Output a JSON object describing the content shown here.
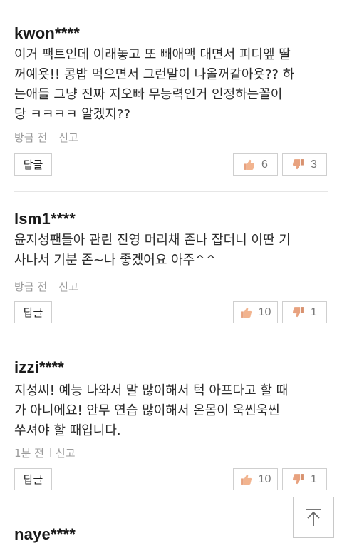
{
  "comments": [
    {
      "author": "kwon****",
      "lines": [
        "이거 팩트인데 이래놓고 또 빼애액 대면서 피디엪 딸",
        "꺼예욧!! 콩밥 먹으면서 그런말이 나올꺼같아욧?? 하",
        "는애들 그냥 진짜 지오빠 무능력인거 인정하는꼴이",
        "당 ㅋㅋㅋㅋ 알겠지??"
      ],
      "time": "방금 전",
      "report": "신고",
      "reply": "답글",
      "likes": "6",
      "dislikes": "3"
    },
    {
      "author": "lsm1****",
      "lines": [
        "윤지성팬들아 관린 진영 머리채 존나 잡더니 이딴 기",
        "사나서 기분 존~나 좋겠어요 아주^^"
      ],
      "time": "방금 전",
      "report": "신고",
      "reply": "답글",
      "likes": "10",
      "dislikes": "1"
    },
    {
      "author": "izzi****",
      "lines": [
        "지성씨! 예능 나와서 말 많이해서 턱 아프다고 할 때",
        "가 아니에요! 안무 연습 많이해서 온몸이 욱씬욱씬",
        "쑤셔야 할 때입니다."
      ],
      "time": "1분 전",
      "report": "신고",
      "reply": "답글",
      "likes": "10",
      "dislikes": "1"
    },
    {
      "author": "naye****"
    }
  ],
  "icons": {
    "like": "thumbs-up-icon",
    "dislike": "thumbs-down-icon",
    "top": "arrow-up-to-top-icon"
  },
  "colors": {
    "thumb_up": "#e8a27f",
    "thumb_down": "#e8a27f",
    "meta_text": "#9a9a9a"
  }
}
